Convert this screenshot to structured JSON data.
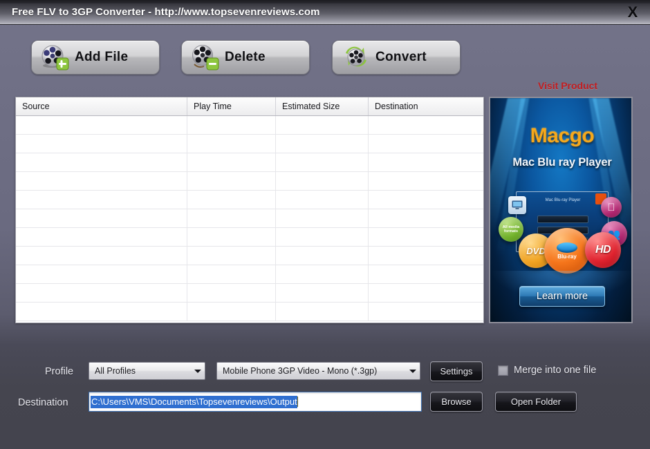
{
  "window": {
    "title": "Free FLV to 3GP Converter - http://www.topsevenreviews.com",
    "close_label": "X",
    "close_icon": "close-icon",
    "bg_color": "#6f6f85",
    "bottom_bg_color": "#44444e"
  },
  "toolbar": {
    "add_file_label": "Add File",
    "add_file_icon": "film-reel-plus-icon",
    "delete_label": "Delete",
    "delete_icon": "film-reel-minus-icon",
    "convert_label": "Convert",
    "convert_icon": "film-reel-refresh-icon",
    "visit_product_label": "Visit Product",
    "visit_product_color": "#c21d20"
  },
  "file_table": {
    "columns": [
      "Source",
      "Play Time",
      "Estimated Size",
      "Destination"
    ],
    "rows": [],
    "empty_row_count": 11
  },
  "ad": {
    "brand": "Macgo",
    "brand_color": "#f5a81c",
    "product": "Mac Blu ray Player",
    "screen_title": "Mac Blu-ray Player",
    "cta_label": "Learn more",
    "badges": {
      "dvd": "DVD",
      "bluray": "Blu-ray",
      "hd": "HD",
      "all_formats": "All media formats",
      "monitor_icon": "monitor-icon",
      "apple_icon": "apple-icon",
      "users_icon": "users-icon"
    }
  },
  "bottom": {
    "profile_label": "Profile",
    "profile_value": "All Profiles",
    "format_value": "Mobile Phone 3GP Video - Mono (*.3gp)",
    "settings_label": "Settings",
    "merge_label": "Merge into one file",
    "merge_checked": false,
    "destination_label": "Destination",
    "destination_value": "C:\\Users\\VMS\\Documents\\Topsevenreviews\\Output",
    "browse_label": "Browse",
    "open_folder_label": "Open Folder",
    "dropdown_icon": "chevron-down-icon",
    "checkbox_icon": "checkbox-unchecked-icon"
  }
}
